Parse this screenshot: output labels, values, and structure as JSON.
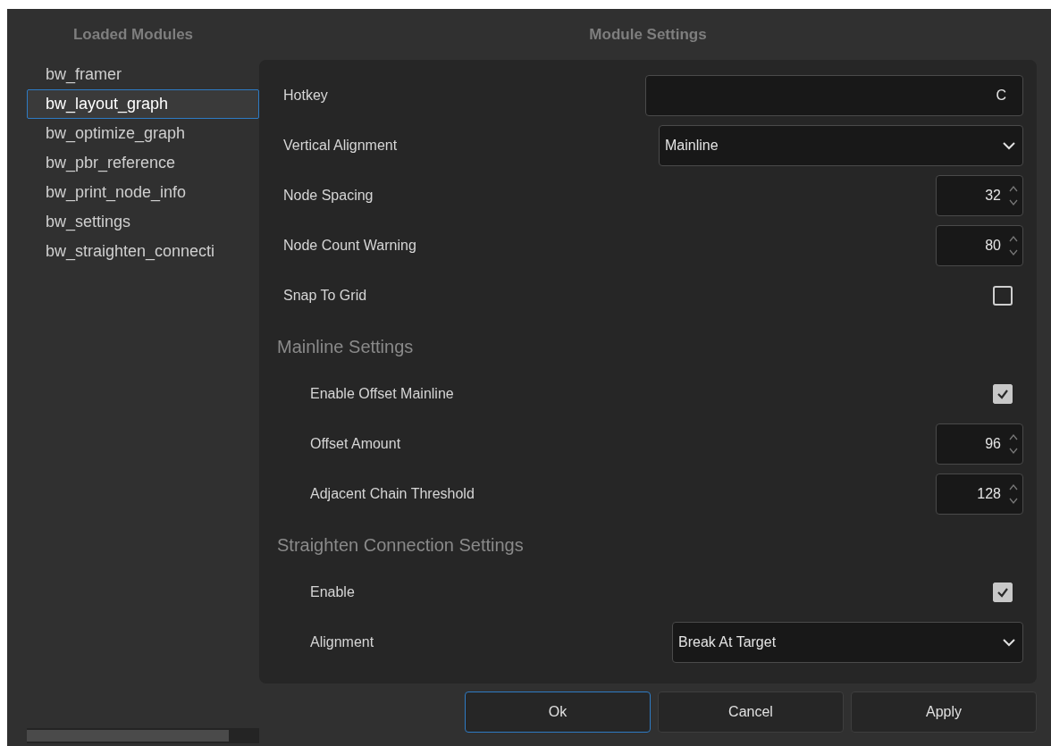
{
  "sidebar": {
    "title": "Loaded Modules",
    "items": [
      {
        "label": "bw_framer",
        "selected": false
      },
      {
        "label": "bw_layout_graph",
        "selected": true
      },
      {
        "label": "bw_optimize_graph",
        "selected": false
      },
      {
        "label": "bw_pbr_reference",
        "selected": false
      },
      {
        "label": "bw_print_node_info",
        "selected": false
      },
      {
        "label": "bw_settings",
        "selected": false
      },
      {
        "label": "bw_straighten_connecti",
        "selected": false
      }
    ]
  },
  "settings": {
    "title": "Module Settings",
    "items": [
      {
        "kind": "text",
        "label": "Hotkey",
        "value": "C"
      },
      {
        "kind": "select",
        "label": "Vertical Alignment",
        "value": "Mainline"
      },
      {
        "kind": "spin",
        "label": "Node Spacing",
        "value": "32"
      },
      {
        "kind": "spin",
        "label": "Node Count Warning",
        "value": "80"
      },
      {
        "kind": "checkbox",
        "label": "Snap To Grid",
        "checked": false
      },
      {
        "kind": "section",
        "label": "Mainline Settings",
        "children": [
          {
            "kind": "checkbox",
            "label": "Enable Offset Mainline",
            "checked": true
          },
          {
            "kind": "spin",
            "label": "Offset Amount",
            "value": "96"
          },
          {
            "kind": "spin",
            "label": "Adjacent Chain Threshold",
            "value": "128"
          }
        ]
      },
      {
        "kind": "section",
        "label": "Straighten Connection Settings",
        "children": [
          {
            "kind": "checkbox",
            "label": "Enable",
            "checked": true
          },
          {
            "kind": "select",
            "label": "Alignment",
            "value": "Break At Target"
          }
        ]
      }
    ]
  },
  "buttons": [
    {
      "label": "Ok",
      "focused": true
    },
    {
      "label": "Cancel",
      "focused": false
    },
    {
      "label": "Apply",
      "focused": false
    }
  ]
}
